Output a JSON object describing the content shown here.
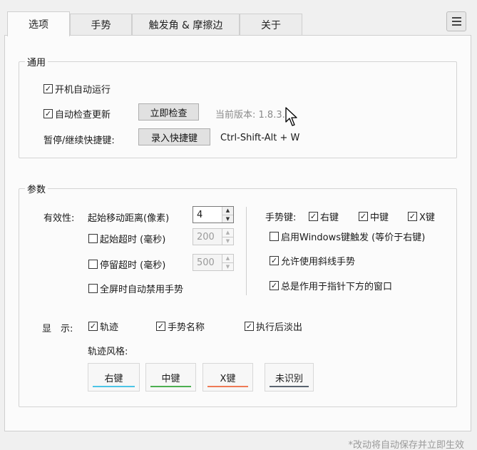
{
  "tabs": [
    "选项",
    "手势",
    "触发角 & 摩擦边",
    "关于"
  ],
  "general": {
    "title": "通用",
    "autostart_label": "开机自动运行",
    "autostart_checked": true,
    "autoupdate_label": "自动检查更新",
    "autoupdate_checked": true,
    "check_now_label": "立即检查",
    "version_label": "当前版本:",
    "version_value": "1.8.3.0",
    "hotkey_label": "暂停/继续快捷键:",
    "record_hotkey_label": "录入快捷键",
    "hotkey_value": "Ctrl-Shift-Alt + W"
  },
  "params": {
    "title": "参数",
    "validity_label": "有效性:",
    "min_distance_label": "起始移动距离(像素)",
    "min_distance_value": "4",
    "start_timeout_label": "起始超时 (毫秒)",
    "start_timeout_checked": false,
    "start_timeout_value": "200",
    "stay_timeout_label": "停留超时 (毫秒)",
    "stay_timeout_checked": false,
    "stay_timeout_value": "500",
    "fullscreen_label": "全屏时自动禁用手势",
    "fullscreen_checked": false,
    "gesture_key_label": "手势键:",
    "right_key_label": "右键",
    "right_key_checked": true,
    "middle_key_label": "中键",
    "middle_key_checked": true,
    "x_key_label": "X键",
    "x_key_checked": true,
    "win_key_label": "启用Windows键触发 (等价于右键)",
    "win_key_checked": false,
    "diagonal_label": "允许使用斜线手势",
    "diagonal_checked": true,
    "under_pointer_label": "总是作用于指针下方的窗口",
    "under_pointer_checked": true,
    "display_label": "显　示:",
    "trail_label": "轨迹",
    "trail_checked": true,
    "gesture_name_label": "手势名称",
    "gesture_name_checked": true,
    "fade_label": "执行后淡出",
    "fade_checked": true,
    "trail_style_label": "轨迹风格:",
    "styles": [
      {
        "label": "右键",
        "color": "#4cc4e6"
      },
      {
        "label": "中键",
        "color": "#4caf50"
      },
      {
        "label": "X键",
        "color": "#ef7a56"
      },
      {
        "label": "未识别",
        "color": "#5a6470"
      }
    ]
  },
  "footer_note": "*改动将自动保存并立即生效",
  "icons": {
    "menu": "hamburger-menu-icon",
    "cursor": "mouse-cursor-icon",
    "check": "checkmark-icon"
  }
}
